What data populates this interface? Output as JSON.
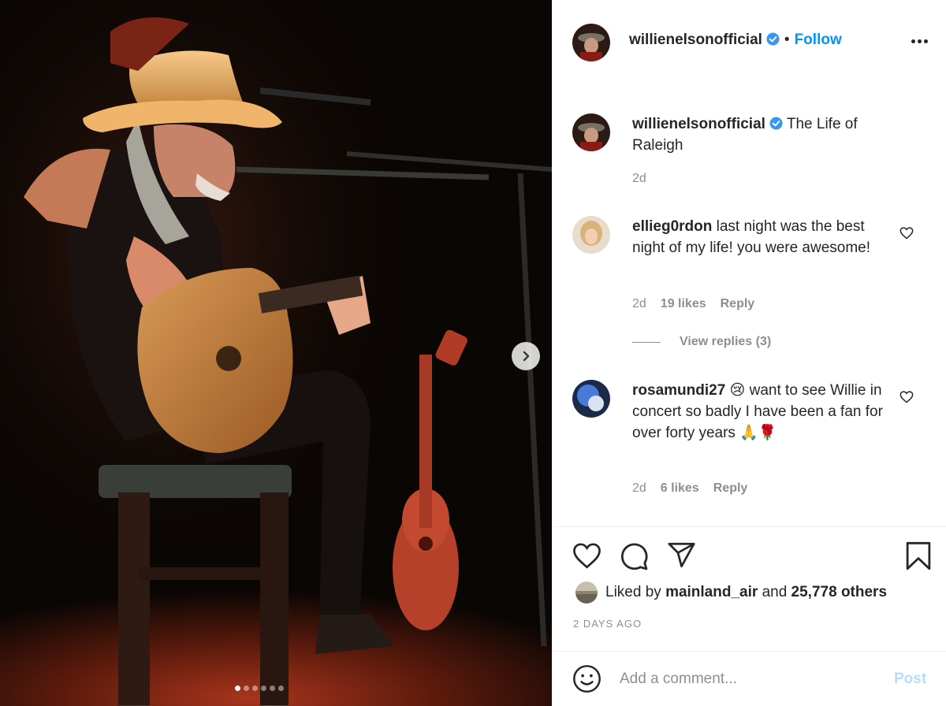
{
  "post": {
    "username": "willienelsonofficial",
    "verified": true,
    "follow_label": "Follow",
    "separator": "•",
    "more_icon": "more-options-icon",
    "carousel": {
      "slide_count": 6,
      "active_index": 0
    }
  },
  "caption": {
    "username": "willienelsonofficial",
    "text": "The Life of Raleigh",
    "time": "2d"
  },
  "comments": [
    {
      "username": "ellieg0rdon",
      "text": "last night was the best night of my life! you were awesome!",
      "time": "2d",
      "likes": "19 likes",
      "reply_label": "Reply",
      "view_replies": "View replies (3)"
    },
    {
      "username": "rosamundi27",
      "emoji": "😢",
      "text": "want to see Willie in concert so badly I have been a fan for over forty years",
      "trailing_emoji": "🙏🌹",
      "time": "2d",
      "likes": "6 likes",
      "reply_label": "Reply"
    }
  ],
  "likes": {
    "prefix": "Liked by",
    "user": "mainland_air",
    "conjunction": "and",
    "others": "25,778 others"
  },
  "timestamp": "2 DAYS AGO",
  "comment_box": {
    "placeholder": "Add a comment...",
    "post_label": "Post"
  },
  "colors": {
    "accent_blue": "#0095f6",
    "muted_text": "#8e8e8e",
    "post_disabled": "#b2dffc"
  }
}
